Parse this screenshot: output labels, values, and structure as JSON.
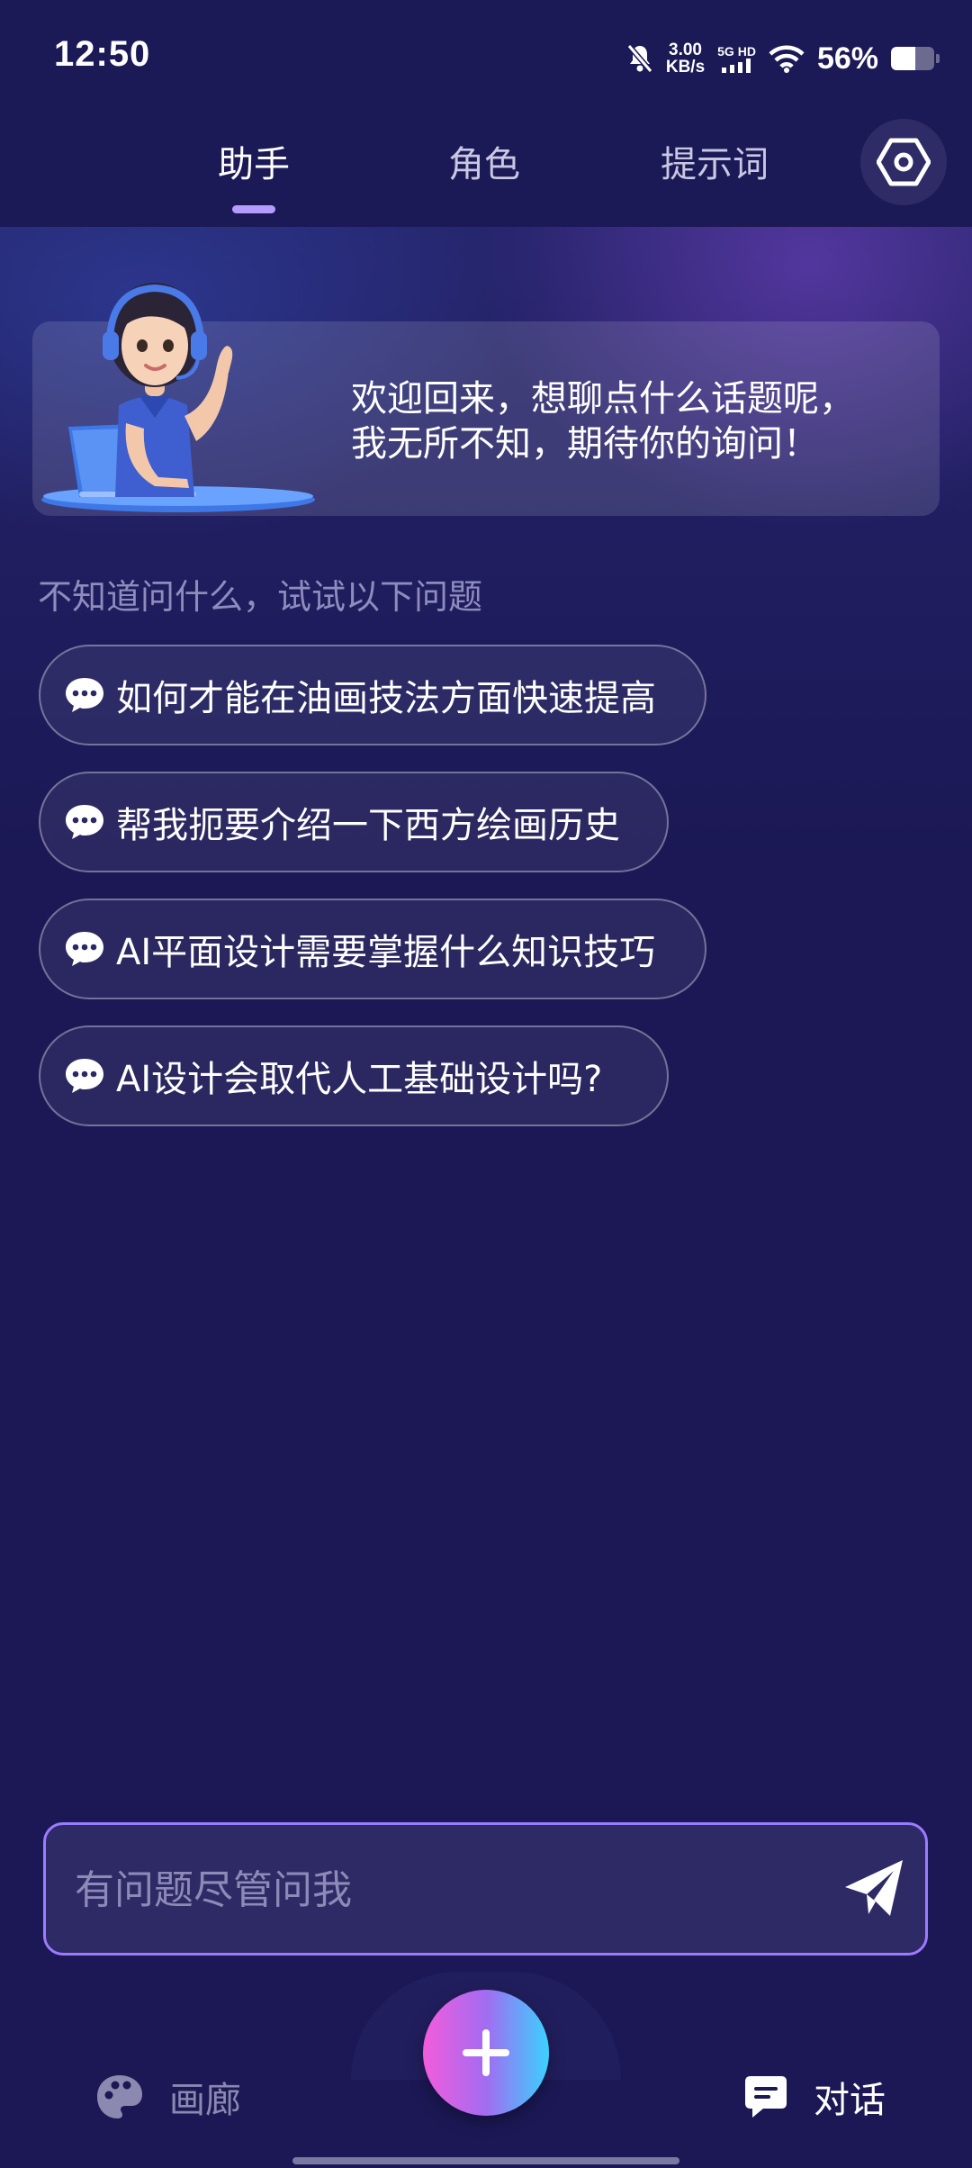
{
  "status_bar": {
    "time": "12:50",
    "net_speed_value": "3.00",
    "net_speed_unit": "KB/s",
    "network_type": "5G HD",
    "battery_percent": "56%",
    "battery_level": 0.56,
    "icons": [
      "mute-bell-icon",
      "signal-icon",
      "wifi-icon",
      "battery-icon"
    ]
  },
  "tabs": {
    "items": [
      {
        "label": "助手",
        "active": true
      },
      {
        "label": "角色",
        "active": false
      },
      {
        "label": "提示词",
        "active": false
      }
    ],
    "settings_icon": "hexagon-settings-icon"
  },
  "welcome": {
    "line1": "欢迎回来，想聊点什么话题呢，",
    "line2": "我无所不知，期待你的询问！"
  },
  "suggestions": {
    "hint": "不知道问什么，试试以下问题",
    "items": [
      "如何才能在油画技法方面快速提高",
      "帮我扼要介绍一下西方绘画历史",
      "AI平面设计需要掌握什么知识技巧",
      "AI设计会取代人工基础设计吗?"
    ]
  },
  "composer": {
    "placeholder": "有问题尽管问我",
    "send_icon": "send-icon"
  },
  "bottom_nav": {
    "gallery_label": "画廊",
    "chat_label": "对话",
    "fab_icon": "plus-icon"
  },
  "colors": {
    "background": "#1b1855",
    "accent": "#9b7bff",
    "tab_indicator": "#b59cff"
  }
}
